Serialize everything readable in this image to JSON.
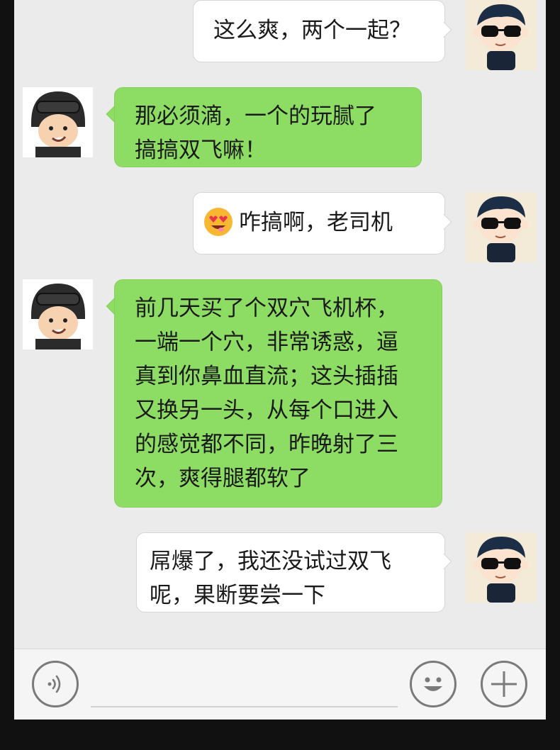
{
  "messages": [
    {
      "side": "right",
      "sender": "me",
      "text": "这么爽，两个一起？"
    },
    {
      "side": "left",
      "sender": "soldier",
      "lines": [
        "那必须滴，一个的玩腻了",
        "搞搞双飞嘛！"
      ]
    },
    {
      "side": "right",
      "sender": "me",
      "emoji": "heart-eyes-emoji",
      "text": "咋搞啊，老司机"
    },
    {
      "side": "left",
      "sender": "soldier",
      "lines": [
        "前几天买了个双穴飞机杯，",
        "一端一个穴，非常诱惑，逼",
        "真到你鼻血直流；这头插插",
        "又换另一头，从每个口进入",
        "的感觉都不同，昨晚射了三",
        "次，爽得腿都软了"
      ]
    },
    {
      "side": "right",
      "sender": "me",
      "lines": [
        "屌爆了，我还没试过双飞",
        "呢，果断要尝一下"
      ]
    }
  ],
  "toolbar": {
    "voice_icon": "voice-icon",
    "emoji_icon": "smiley-icon",
    "plus_icon": "plus-icon",
    "input_value": ""
  },
  "colors": {
    "chat_bg": "#ebebeb",
    "green_bubble": "#8ddc64",
    "white_bubble": "#ffffff",
    "toolbar_bg": "#f5f5f5",
    "outer_bg": "#111111"
  }
}
